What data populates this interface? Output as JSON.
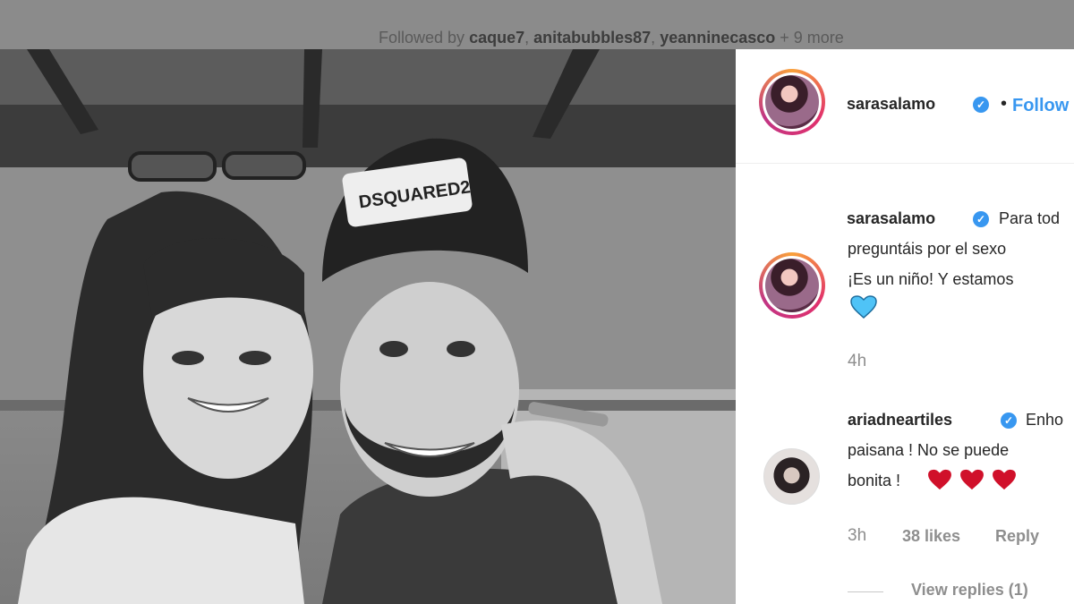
{
  "top": {
    "followed_prefix": "Followed by ",
    "followers": [
      "caque7",
      "anitabubbles87",
      "yeanninecasco"
    ],
    "followed_suffix": " + 9 more"
  },
  "photo": {
    "cap_text_1": "DSQUARED2",
    "description_icon": "photo"
  },
  "header": {
    "username": "sarasalamo",
    "dot": "•",
    "follow_label": "Follow"
  },
  "caption": {
    "username": "sarasalamo",
    "line1": "Para tod",
    "line2": "preguntáis por el sexo",
    "line3": "¡Es un niño! Y estamos",
    "emoji": "blue-heart-icon",
    "time": "4h"
  },
  "comment": {
    "username": "ariadneartiles",
    "line1": "Enho",
    "line2": "paisana ! No se puede",
    "line3": "bonita !",
    "emoji": "red-heart-icon",
    "time": "3h",
    "likes": "38 likes",
    "reply_label": "Reply",
    "view_replies": "View replies (1)"
  },
  "colors": {
    "link": "#3897f0",
    "text": "#262626",
    "muted": "#8e8e8e",
    "heart_red": "#e0245e",
    "heart_blue": "#4fc3f7"
  }
}
